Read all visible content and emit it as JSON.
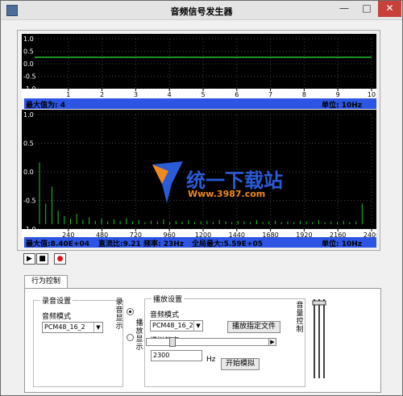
{
  "window": {
    "title": "音频信号发生器"
  },
  "plot1": {
    "y_ticks": [
      "1.0",
      "0.5",
      "0.0",
      "-0.5",
      "-1.0"
    ],
    "x_ticks": [
      "1",
      "2",
      "3",
      "4",
      "5",
      "6",
      "7",
      "8",
      "9",
      "10"
    ],
    "line_color": "#22c22c",
    "line_level": 0.0
  },
  "status1": {
    "max_value": "最大值为: 4",
    "unit": "单位: 10Hz"
  },
  "plot2": {
    "y_ticks": [
      "1.0",
      "0.5",
      "0.0",
      "-0.5",
      "-1.0"
    ],
    "x_ticks": [
      "240",
      "480",
      "720",
      "960",
      "1200",
      "1440",
      "1680",
      "1920",
      "2160",
      "2400"
    ],
    "bar_color": "#22c22c"
  },
  "status2": {
    "max_value": "最大值:8.40E+04",
    "dc_ratio": "直流比:9.21",
    "frequency": "频率: 23Hz",
    "global_max": "全局最大:5.59E+05",
    "unit": "单位: 10Hz"
  },
  "controls": {
    "play": "▶",
    "stop": "■",
    "record": "●"
  },
  "tab": {
    "label": "行为控制"
  },
  "record_group": {
    "title": "录音设置",
    "mode_label": "音频模式",
    "mode_value": "PCM48_16_2"
  },
  "display": {
    "record_display": "录音显示",
    "play_display": "播放显示"
  },
  "play_group": {
    "title": "播放设置",
    "mode_label": "音频模式",
    "mode_value": "PCM48_16_2",
    "play_file_button": "播放指定文件",
    "sim_freq_label": "模拟频率:",
    "freq_value": "2300",
    "freq_unit": "Hz",
    "start_sim_button": "开始模拟"
  },
  "volume": {
    "label": "音量控制"
  },
  "watermark": {
    "brand": "统一下载站",
    "url": "Www.3987.com"
  }
}
